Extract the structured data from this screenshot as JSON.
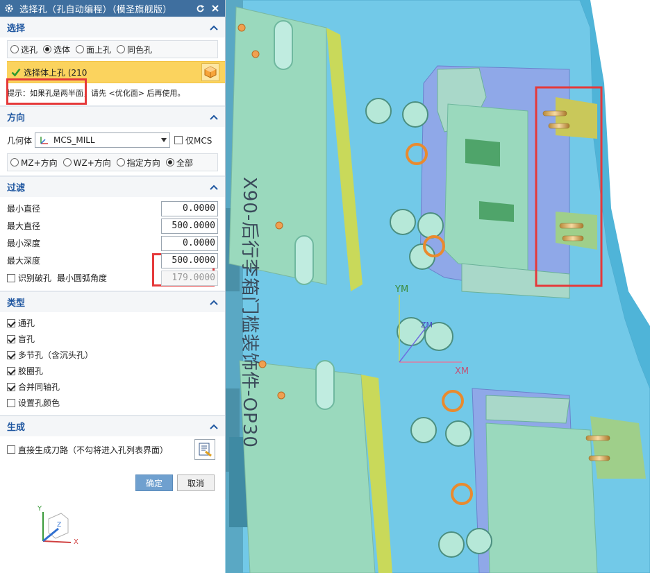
{
  "dialog": {
    "title": "选择孔（孔自动编程）（模圣旗舰版）",
    "title_icons": [
      "gear-icon",
      "reset-icon",
      "close-icon"
    ]
  },
  "select": {
    "header": "选择",
    "options": [
      "选孔",
      "选体",
      "面上孔",
      "同色孔"
    ],
    "selected": "选体",
    "body_label": "选择体上孔 (210",
    "hint": "提示：如果孔是两半面，请先 <优化面> 后再使用。"
  },
  "direction": {
    "header": "方向",
    "geometry_label": "几何体",
    "geometry_value": "MCS_MILL",
    "only_mcs_label": "仅MCS",
    "only_mcs_checked": false,
    "options": [
      "MZ+方向",
      "WZ+方向",
      "指定方向",
      "全部"
    ],
    "selected": "全部"
  },
  "filter": {
    "header": "过滤",
    "min_diameter_label": "最小直径",
    "min_diameter_value": "0.0000",
    "max_diameter_label": "最大直径",
    "max_diameter_value": "500.0000",
    "min_depth_label": "最小深度",
    "min_depth_value": "0.0000",
    "max_depth_label": "最大深度",
    "max_depth_value": "500.0000",
    "broken_hole_label": "识别破孔",
    "broken_hole_checked": false,
    "min_arc_angle_label": "最小圆弧角度",
    "min_arc_angle_value": "179.0000"
  },
  "type": {
    "header": "类型",
    "items": [
      {
        "label": "通孔",
        "checked": true
      },
      {
        "label": "盲孔",
        "checked": true
      },
      {
        "label": "多节孔（含沉头孔）",
        "checked": true
      },
      {
        "label": "胶圈孔",
        "checked": true
      },
      {
        "label": "合并同轴孔",
        "checked": true
      },
      {
        "label": "设置孔颜色",
        "checked": false
      }
    ]
  },
  "generate": {
    "header": "生成",
    "direct_toolpath_label": "直接生成刀路（不勾将进入孔列表界面）",
    "direct_toolpath_checked": false
  },
  "footer": {
    "ok_label": "确定",
    "cancel_label": "取消"
  },
  "viewport": {
    "part_text": "X90-后行李箱门槛装饰件-OP30",
    "axis_ym": "YM",
    "axis_xm": "XM",
    "axis_zm": "ZM",
    "triad_x": "X",
    "triad_y": "Y",
    "triad_z": "Z"
  },
  "colors": {
    "title_bar": "#3f6f9f",
    "section_header_text": "#1e56a0",
    "selection_highlight": "#fbd35e",
    "part_cyan": "#6ec6e6",
    "part_green": "#9fdcc0",
    "highlight_box": "#e5393a",
    "ok_button": "#6fa0cf"
  }
}
